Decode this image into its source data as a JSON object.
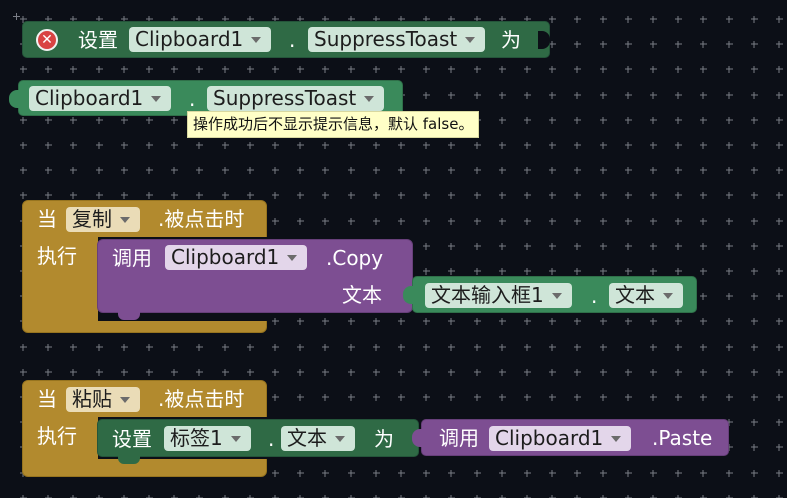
{
  "blocks": {
    "set_suppress": {
      "keyword": "设置",
      "component": "Clipboard1",
      "dot": ".",
      "property": "SuppressToast",
      "to_keyword": "为"
    },
    "get_suppress": {
      "component": "Clipboard1",
      "dot": ".",
      "property": "SuppressToast"
    },
    "tooltip": "操作成功后不显示提示信息，默认 false。",
    "event_copy": {
      "when_keyword": "当",
      "component": "复制",
      "event_suffix": ".被点击时",
      "do_keyword": "执行",
      "call": {
        "keyword": "调用",
        "component": "Clipboard1",
        "method": ".Copy",
        "arg_label": "文本",
        "arg_component": "文本输入框1",
        "arg_dot": ".",
        "arg_property": "文本"
      }
    },
    "event_paste": {
      "when_keyword": "当",
      "component": "粘贴",
      "event_suffix": ".被点击时",
      "do_keyword": "执行",
      "set": {
        "keyword": "设置",
        "component": "标签1",
        "dot": ".",
        "property": "文本",
        "to_keyword": "为"
      },
      "call": {
        "keyword": "调用",
        "component": "Clipboard1",
        "method": ".Paste"
      }
    }
  },
  "colors": {
    "workspace_bg": "#0c0f17",
    "grid_cross": "#7a7d86",
    "setter_green": "#2f6a45",
    "getter_green": "#3a8a5b",
    "method_purple": "#7d4e92",
    "event_gold": "#b28a2e",
    "tooltip_bg": "#ffffc7",
    "error_red": "#d94343"
  },
  "icons": {
    "warning": "error-x-icon",
    "dropdown": "chevron-down-icon"
  }
}
